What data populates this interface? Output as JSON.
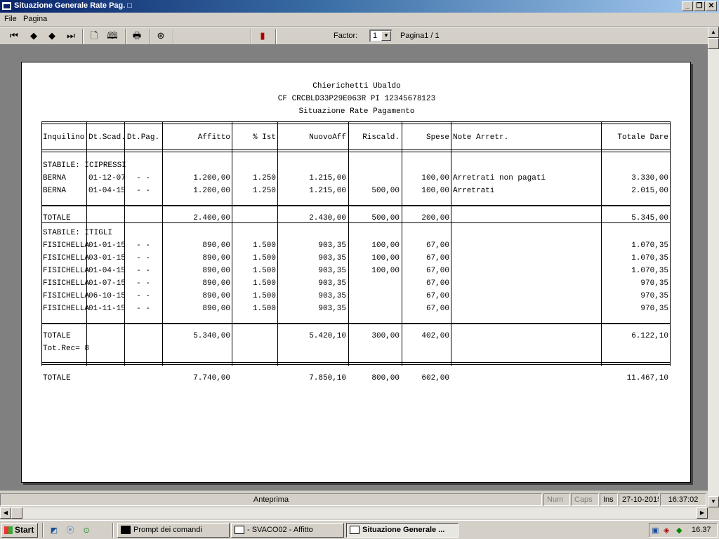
{
  "window": {
    "title": "Situazione Generale Rate Pag. □",
    "icons": [
      "minimize-icon",
      "maximize-icon",
      "close-icon"
    ]
  },
  "menu": {
    "file": "File",
    "pagina": "Pagina"
  },
  "toolbar": {
    "factor_label": "Factor:",
    "factor_value": "1",
    "page_label": "Pagina1 / 1",
    "icons": [
      "first-page-icon",
      "prev-page-icon",
      "next-page-icon",
      "last-page-icon",
      "single-page-icon",
      "two-page-icon",
      "print-icon",
      "export-icon",
      "exit-door-icon"
    ]
  },
  "report": {
    "owner": "Chierichetti Ubaldo",
    "fiscal": "CF CRCBLD33P29E063R   PI 12345678123",
    "title": "Situazione Rate Pagamento",
    "headers": [
      "Inquilino",
      "Dt.Scad.",
      "Dt.Pag.",
      "Affitto",
      "% Ist",
      "NuovoAff",
      "Riscald.",
      "Spese",
      "Note Arretr.",
      "Totale Dare"
    ],
    "groups": [
      {
        "label": "STABILE: ICIPRESSI",
        "rows": [
          [
            "BERNA",
            "01-12-07",
            "- -",
            "1.200,00",
            "1.250",
            "1.215,00",
            "",
            "100,00",
            "Arretrati non pagati",
            "3.330,00"
          ],
          [
            "BERNA",
            "01-04-15",
            "- -",
            "1.200,00",
            "1.250",
            "1.215,00",
            "500,00",
            "100,00",
            "Arretrati",
            "2.015,00"
          ]
        ],
        "total": [
          "TOTALE",
          "",
          "",
          "2.400,00",
          "",
          "2.430,00",
          "500,00",
          "200,00",
          "",
          "5.345,00"
        ]
      },
      {
        "label": "STABILE: ITIGLI",
        "rows": [
          [
            "FISICHELLA",
            "01-01-15",
            "- -",
            "890,00",
            "1.500",
            "903,35",
            "100,00",
            "67,00",
            "",
            "1.070,35"
          ],
          [
            "FISICHELLA",
            "03-01-15",
            "- -",
            "890,00",
            "1.500",
            "903,35",
            "100,00",
            "67,00",
            "",
            "1.070,35"
          ],
          [
            "FISICHELLA",
            "01-04-15",
            "- -",
            "890,00",
            "1.500",
            "903,35",
            "100,00",
            "67,00",
            "",
            "1.070,35"
          ],
          [
            "FISICHELLA",
            "01-07-15",
            "- -",
            "890,00",
            "1.500",
            "903,35",
            "",
            "67,00",
            "",
            "970,35"
          ],
          [
            "FISICHELLA",
            "06-10-15",
            "- -",
            "890,00",
            "1.500",
            "903,35",
            "",
            "67,00",
            "",
            "970,35"
          ],
          [
            "FISICHELLA",
            "01-11-15",
            "- -",
            "890,00",
            "1.500",
            "903,35",
            "",
            "67,00",
            "",
            "970,35"
          ]
        ],
        "total": [
          "TOTALE",
          "",
          "",
          "5.340,00",
          "",
          "5.420,10",
          "300,00",
          "402,00",
          "",
          "6.122,10"
        ],
        "tot_rec": "Tot.Rec= 8"
      }
    ],
    "grand_total": [
      "TOTALE",
      "",
      "",
      "7.740,00",
      "",
      "7.850,10",
      "800,00",
      "602,00",
      "",
      "11.467,10"
    ]
  },
  "status": {
    "mode": "Anteprima",
    "num": "Num",
    "caps": "Caps",
    "ins": "Ins",
    "date": "27-10-2015",
    "time": "16:37:02"
  },
  "taskbar": {
    "start": "Start",
    "tasks": [
      "Prompt dei comandi",
      "- SVACO02 - Affitto",
      "Situazione Generale ..."
    ],
    "clock": "16.37"
  }
}
